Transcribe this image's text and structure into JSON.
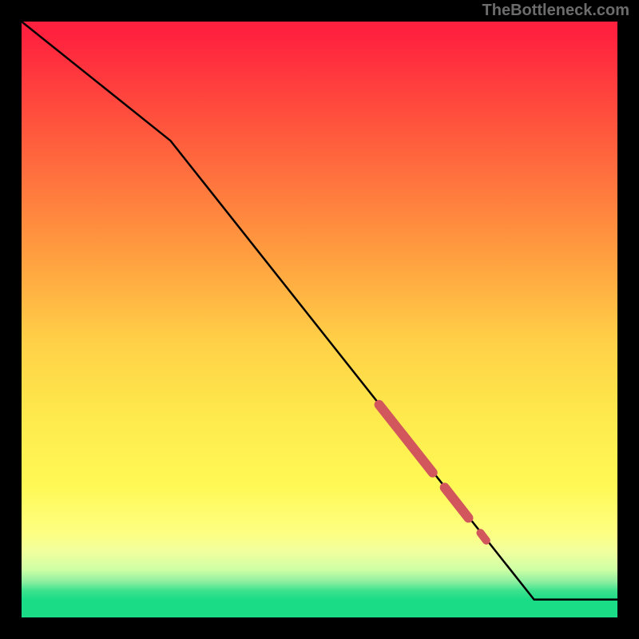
{
  "watermark": "TheBottleneck.com",
  "chart_data": {
    "type": "line",
    "title": "",
    "xlabel": "",
    "ylabel": "",
    "xlim": [
      0,
      100
    ],
    "ylim": [
      0,
      100
    ],
    "series": [
      {
        "name": "main-curve",
        "x": [
          0,
          25,
          86,
          100
        ],
        "y": [
          100,
          80,
          3,
          3
        ]
      }
    ],
    "highlights": [
      {
        "name": "segment-1",
        "x_start": 60,
        "y_start": 35.7,
        "x_end": 69,
        "y_end": 24.3,
        "weight": "thick"
      },
      {
        "name": "segment-2",
        "x_start": 71,
        "y_start": 21.8,
        "x_end": 75,
        "y_end": 16.7,
        "weight": "thick"
      },
      {
        "name": "dot-1",
        "x_start": 77,
        "y_start": 14.2,
        "x_end": 78,
        "y_end": 12.9,
        "weight": "dot"
      }
    ],
    "highlight_color": "#d1575d",
    "line_color": "#000000",
    "gradient_stops": [
      {
        "pos": 0,
        "color": "#ff213e"
      },
      {
        "pos": 0.2,
        "color": "#ff5d3d"
      },
      {
        "pos": 0.38,
        "color": "#ff9a3f"
      },
      {
        "pos": 0.54,
        "color": "#ffd147"
      },
      {
        "pos": 0.66,
        "color": "#fee94c"
      },
      {
        "pos": 0.78,
        "color": "#fff955"
      },
      {
        "pos": 0.86,
        "color": "#fdff83"
      },
      {
        "pos": 0.92,
        "color": "#ceffa5"
      },
      {
        "pos": 0.96,
        "color": "#3de28e"
      },
      {
        "pos": 1.0,
        "color": "#1bdc86"
      }
    ]
  }
}
